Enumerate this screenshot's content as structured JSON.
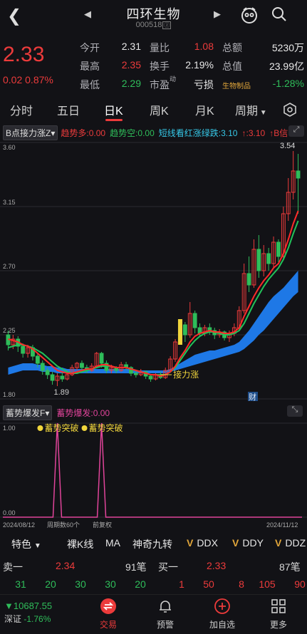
{
  "header": {
    "back_icon": "chevron-left-icon",
    "title": "四环生物",
    "code": "000518",
    "code_tag": "ⓩ"
  },
  "quote": {
    "price": "2.33",
    "change_abs": "0.02",
    "change_pct": "0.87%",
    "rows": [
      [
        {
          "label": "今开",
          "value": "2.31",
          "color": "white"
        },
        {
          "label": "量比",
          "value": "1.08",
          "color": "red"
        },
        {
          "label": "总额",
          "value": "5230万",
          "color": "white"
        }
      ],
      [
        {
          "label": "最高",
          "value": "2.35",
          "color": "red"
        },
        {
          "label": "换手",
          "value": "2.19%",
          "color": "white"
        },
        {
          "label": "总值",
          "value": "23.99亿",
          "color": "white"
        }
      ],
      [
        {
          "label": "最低",
          "value": "2.29",
          "color": "green"
        },
        {
          "label": "市盈",
          "value": "亏损",
          "color": "white"
        },
        {
          "label": "生物制品",
          "value": "-1.28%",
          "color": "green"
        }
      ]
    ],
    "pe_superscript": "动"
  },
  "tabs": [
    "分时",
    "五日",
    "日K",
    "周K",
    "月K",
    "周期"
  ],
  "active_tab": "日K",
  "legend_main": {
    "selector": "B点接力涨Z",
    "items": [
      {
        "text": "趋势多:0.00",
        "color": "red"
      },
      {
        "text": "趋势空:0.00",
        "color": "green"
      },
      {
        "text": "短线看红涨绿跌:3.10",
        "color": "cyan"
      },
      {
        "text": "↑:3.10",
        "color": "red"
      },
      {
        "text": "↑B信",
        "color": "red"
      }
    ]
  },
  "legend_sub": {
    "selector": "蓄势爆发F",
    "items": [
      {
        "text": "蓄势爆发:0.00",
        "color": "magenta"
      }
    ]
  },
  "chart_data": {
    "type": "candlestick",
    "y_ticks": [
      "3.60",
      "3.15",
      "2.70",
      "2.25",
      "1.80"
    ],
    "ylim": [
      1.8,
      3.6
    ],
    "high_label": "3.54",
    "low_label": "1.89",
    "annotation": "接力涨",
    "flag_label": "财",
    "x_start": "2024/08/12",
    "x_end": "2024/11/12",
    "x_mid_labels": [
      "周期数60个",
      "前复权"
    ],
    "candles": [
      [
        2.25,
        2.18,
        2.28,
        2.14
      ],
      [
        2.18,
        2.22,
        2.25,
        2.15
      ],
      [
        2.22,
        2.17,
        2.24,
        2.13
      ],
      [
        2.17,
        2.12,
        2.19,
        2.09
      ],
      [
        2.12,
        2.16,
        2.18,
        2.09
      ],
      [
        2.16,
        2.1,
        2.18,
        2.07
      ],
      [
        2.1,
        2.05,
        2.12,
        2.02
      ],
      [
        2.05,
        2.0,
        2.07,
        1.97
      ],
      [
        2.0,
        1.97,
        2.02,
        1.94
      ],
      [
        1.97,
        1.93,
        1.99,
        1.9
      ],
      [
        1.93,
        1.96,
        1.98,
        1.89
      ],
      [
        1.96,
        1.94,
        1.99,
        1.92
      ],
      [
        1.94,
        1.97,
        2.0,
        1.93
      ],
      [
        1.97,
        2.02,
        2.04,
        1.96
      ],
      [
        2.02,
        2.05,
        2.06,
        2.0
      ],
      [
        2.05,
        2.02,
        2.07,
        2.0
      ],
      [
        2.02,
        2.0,
        2.04,
        1.98
      ],
      [
        2.0,
        2.03,
        2.05,
        1.99
      ],
      [
        2.03,
        2.12,
        2.13,
        2.02
      ],
      [
        2.12,
        2.05,
        2.13,
        2.02
      ],
      [
        2.05,
        2.0,
        2.07,
        1.98
      ],
      [
        2.0,
        2.02,
        2.04,
        1.98
      ],
      [
        2.02,
        2.0,
        2.03,
        1.98
      ],
      [
        2.0,
        2.04,
        2.06,
        1.99
      ],
      [
        2.04,
        2.02,
        2.06,
        2.0
      ],
      [
        2.02,
        1.98,
        2.03,
        1.96
      ],
      [
        1.98,
        1.97,
        2.0,
        1.95
      ],
      [
        1.97,
        1.99,
        2.01,
        1.96
      ],
      [
        1.99,
        1.96,
        2.0,
        1.94
      ],
      [
        1.96,
        1.94,
        1.97,
        1.92
      ],
      [
        1.94,
        1.97,
        1.98,
        1.93
      ],
      [
        1.97,
        1.95,
        1.99,
        1.94
      ],
      [
        1.95,
        2.0,
        2.02,
        1.94
      ],
      [
        2.0,
        2.08,
        2.1,
        1.99
      ],
      [
        2.08,
        2.2,
        2.22,
        2.06
      ],
      [
        2.2,
        2.32,
        2.36,
        2.18
      ],
      [
        2.32,
        2.25,
        2.34,
        2.2
      ],
      [
        2.25,
        2.4,
        2.48,
        2.23
      ],
      [
        2.4,
        2.3,
        2.42,
        2.26
      ],
      [
        2.3,
        2.26,
        2.33,
        2.24
      ],
      [
        2.26,
        2.3,
        2.32,
        2.24
      ],
      [
        2.3,
        2.28,
        2.33,
        2.25
      ],
      [
        2.28,
        2.25,
        2.3,
        2.22
      ],
      [
        2.25,
        2.27,
        2.29,
        2.23
      ],
      [
        2.27,
        2.23,
        2.28,
        2.21
      ],
      [
        2.23,
        2.26,
        2.28,
        2.2
      ],
      [
        2.26,
        2.3,
        2.33,
        2.24
      ],
      [
        2.3,
        2.42,
        2.45,
        2.28
      ],
      [
        2.42,
        2.68,
        2.75,
        2.4
      ],
      [
        2.68,
        2.6,
        2.8,
        2.55
      ],
      [
        2.6,
        2.85,
        2.92,
        2.58
      ],
      [
        2.85,
        2.7,
        2.95,
        2.65
      ],
      [
        2.7,
        2.82,
        2.88,
        2.66
      ],
      [
        2.82,
        2.75,
        2.86,
        2.7
      ],
      [
        2.75,
        2.9,
        2.94,
        2.72
      ],
      [
        2.9,
        2.8,
        2.92,
        2.76
      ],
      [
        2.8,
        3.1,
        3.15,
        2.78
      ],
      [
        3.1,
        3.25,
        3.35,
        3.05
      ],
      [
        3.25,
        3.4,
        3.54,
        3.2
      ],
      [
        3.4,
        3.35,
        3.52,
        3.1
      ]
    ],
    "ma_red": [
      2.22,
      2.21,
      2.2,
      2.18,
      2.17,
      2.15,
      2.12,
      2.09,
      2.06,
      2.03,
      2.0,
      1.99,
      1.98,
      1.98,
      1.99,
      2.0,
      2.01,
      2.01,
      2.03,
      2.04,
      2.04,
      2.03,
      2.02,
      2.02,
      2.02,
      2.01,
      2.0,
      1.99,
      1.98,
      1.97,
      1.97,
      1.96,
      1.97,
      1.99,
      2.03,
      2.09,
      2.14,
      2.2,
      2.24,
      2.26,
      2.27,
      2.28,
      2.27,
      2.27,
      2.26,
      2.26,
      2.27,
      2.3,
      2.38,
      2.45,
      2.52,
      2.58,
      2.63,
      2.67,
      2.72,
      2.75,
      2.82,
      2.92,
      3.03,
      3.12
    ],
    "ma_green": [
      2.16,
      2.17,
      2.18,
      2.18,
      2.17,
      2.16,
      2.14,
      2.12,
      2.09,
      2.06,
      2.03,
      2.01,
      1.99,
      1.98,
      1.98,
      1.99,
      2.0,
      2.01,
      2.02,
      2.03,
      2.03,
      2.03,
      2.02,
      2.02,
      2.02,
      2.01,
      2.0,
      1.99,
      1.98,
      1.97,
      1.97,
      1.97,
      1.97,
      1.99,
      2.02,
      2.07,
      2.12,
      2.17,
      2.21,
      2.24,
      2.26,
      2.27,
      2.27,
      2.26,
      2.25,
      2.25,
      2.26,
      2.28,
      2.33,
      2.4,
      2.47,
      2.53,
      2.59,
      2.64,
      2.68,
      2.72,
      2.78,
      2.86,
      2.96,
      3.05
    ],
    "band_top": [
      2.02,
      2.03,
      2.04,
      2.05,
      2.05,
      2.05,
      2.04,
      2.04,
      2.03,
      2.03,
      2.02,
      2.02,
      2.01,
      2.01,
      2.01,
      2.01,
      2.01,
      2.01,
      2.01,
      2.01,
      2.01,
      2.01,
      2.01,
      2.01,
      2.01,
      2.01,
      2.0,
      2.0,
      2.0,
      2.0,
      2.0,
      2.0,
      2.0,
      2.01,
      2.03,
      2.05,
      2.07,
      2.09,
      2.11,
      2.12,
      2.13,
      2.14,
      2.14,
      2.15,
      2.16,
      2.17,
      2.18,
      2.2,
      2.24,
      2.28,
      2.33,
      2.38,
      2.43,
      2.48,
      2.52,
      2.55,
      2.58,
      2.62,
      2.66,
      2.7
    ],
    "band_bottom": [
      1.97,
      1.98,
      1.99,
      2.0,
      2.0,
      2.0,
      2.0,
      1.99,
      1.99,
      1.99,
      1.98,
      1.98,
      1.98,
      1.98,
      1.98,
      1.98,
      1.98,
      1.98,
      1.98,
      1.98,
      1.98,
      1.98,
      1.98,
      1.98,
      1.98,
      1.98,
      1.98,
      1.98,
      1.98,
      1.98,
      1.98,
      1.98,
      1.98,
      1.99,
      2.0,
      2.01,
      2.02,
      2.03,
      2.04,
      2.05,
      2.06,
      2.07,
      2.08,
      2.09,
      2.1,
      2.11,
      2.12,
      2.13,
      2.15,
      2.18,
      2.21,
      2.25,
      2.28,
      2.32,
      2.36,
      2.4,
      2.44,
      2.48,
      2.52,
      2.55
    ],
    "sub_ticks": [
      "1.00",
      "0.00"
    ],
    "sub_labels": [
      "蓄势突破",
      "蓄势突破"
    ],
    "spikes": [
      10,
      19
    ]
  },
  "indicator_bar": {
    "feature": "特色",
    "items": [
      "裸K线",
      "MA",
      "神奇九转",
      "DDX",
      "DDY",
      "DDZ"
    ]
  },
  "orderbook": {
    "sell_label": "卖一",
    "sell_price": "2.34",
    "sell_count": "91笔",
    "buy_label": "买一",
    "buy_price": "2.33",
    "buy_count": "87笔",
    "sell_queue": [
      "31",
      "20",
      "30",
      "30",
      "20"
    ],
    "buy_queue": [
      "1",
      "50",
      "8",
      "105",
      "90"
    ]
  },
  "nav": {
    "index_value": "10687.55",
    "index_name": "深证",
    "index_change": "-1.76%",
    "items": [
      {
        "label": "交易",
        "icon": "exchange-icon"
      },
      {
        "label": "预警",
        "icon": "bell-icon"
      },
      {
        "label": "加自选",
        "icon": "plus-circle-icon"
      },
      {
        "label": "更多",
        "icon": "grid-icon"
      }
    ]
  },
  "colors": {
    "up": "#ec3b3b",
    "down": "#2fbd5a",
    "band": "#1e78e6",
    "ma_up": "#ff2a2a",
    "ma_down": "#22c25a"
  }
}
